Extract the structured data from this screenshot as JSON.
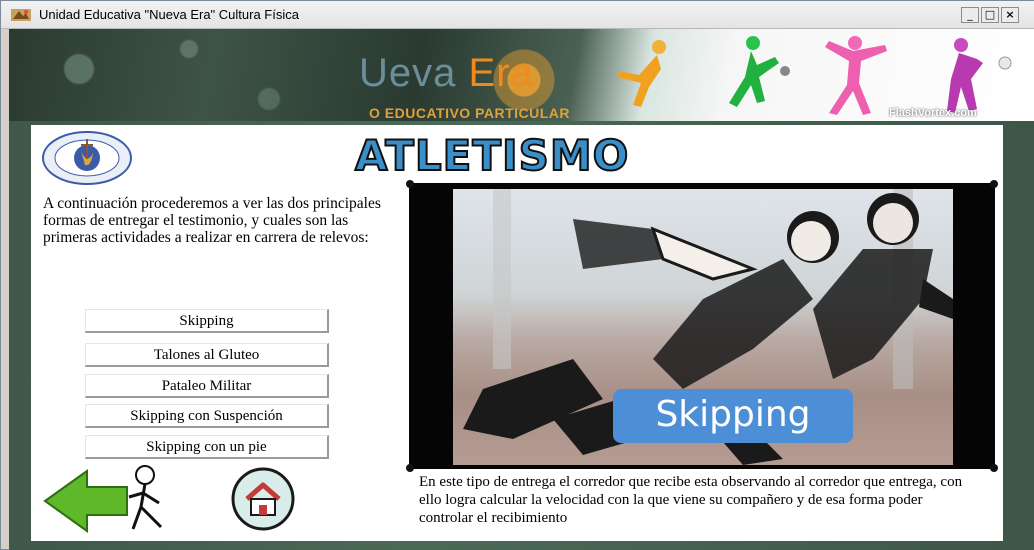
{
  "window": {
    "title": "Unidad Educativa \"Nueva Era\" Cultura Física",
    "min_glyph": "_",
    "max_glyph": "□",
    "close_glyph": "×"
  },
  "banner": {
    "logo_prefix": "Ueva",
    "logo_suffix": "Era",
    "subtitle": "O EDUCATIVO PARTICULAR",
    "watermark": "FlashVortex.com"
  },
  "page": {
    "heading": "ATLETISMO",
    "intro": "A continuación procederemos a ver las dos principales formas de entregar el testimonio, y cuales son las primeras actividades a realizar en carrera de relevos:",
    "menu": [
      {
        "label": "Skipping"
      },
      {
        "label": "Talones al Gluteo"
      },
      {
        "label": "Pataleo Militar"
      },
      {
        "label": "Skipping con Suspención"
      },
      {
        "label": "Skipping con un pie"
      }
    ],
    "media_caption": "Skipping",
    "description": "En este tipo de entrega el corredor que recibe esta observando al corredor que entrega, con ello logra calcular la velocidad con la que viene su compañero y de esa forma poder controlar el recibimiento"
  },
  "icons": {
    "app": "app-logo-icon",
    "seal": "university-seal-icon",
    "back": "back-arrow-icon",
    "home": "home-icon"
  },
  "colors": {
    "heading_fill": "#3a8fc9",
    "caption_bg": "#4d8fd6",
    "banner_orange": "#f28a1b",
    "back_arrow": "#5fb829"
  }
}
